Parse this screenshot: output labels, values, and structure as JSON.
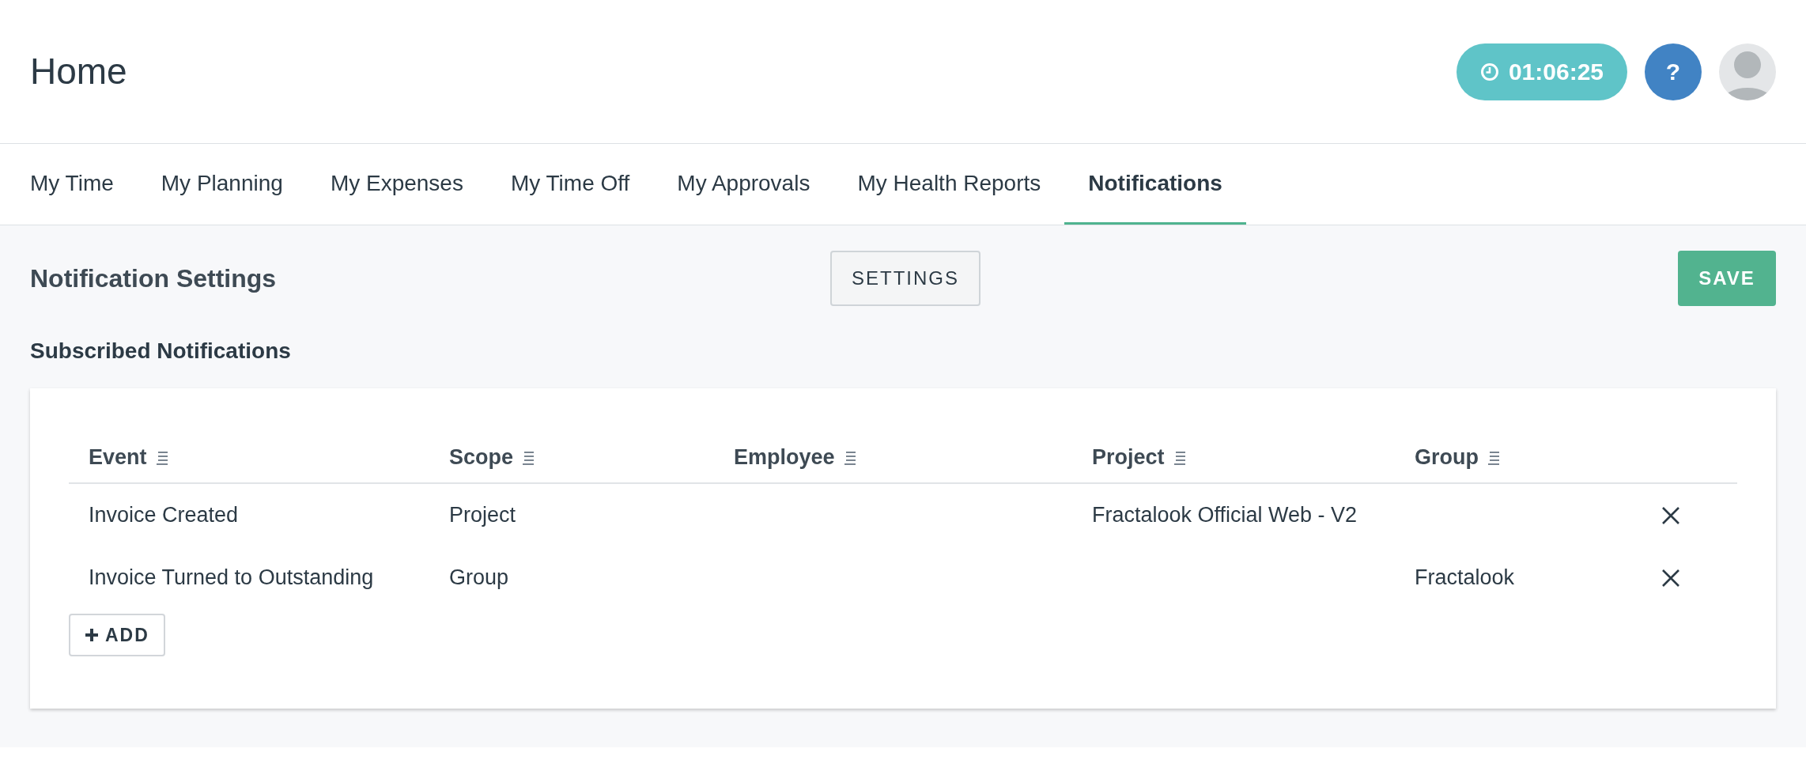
{
  "header": {
    "title": "Home",
    "timer": "01:06:25",
    "help": "?"
  },
  "tabs": [
    {
      "label": "My Time",
      "selected": false
    },
    {
      "label": "My Planning",
      "selected": false
    },
    {
      "label": "My Expenses",
      "selected": false
    },
    {
      "label": "My Time Off",
      "selected": false
    },
    {
      "label": "My Approvals",
      "selected": false
    },
    {
      "label": "My Health Reports",
      "selected": false
    },
    {
      "label": "Notifications",
      "selected": true
    }
  ],
  "toolbar": {
    "title": "Notification Settings",
    "settings_button": "SETTINGS",
    "save_button": "SAVE"
  },
  "section_title": "Subscribed Notifications",
  "table": {
    "columns": [
      "Event",
      "Scope",
      "Employee",
      "Project",
      "Group"
    ],
    "rows": [
      [
        "Invoice Created",
        "Project",
        "",
        "Fractalook Official Web - V2",
        ""
      ],
      [
        "Invoice Turned to Outstanding",
        "Group",
        "",
        "",
        "Fractalook"
      ]
    ],
    "add_button": "ADD"
  }
}
